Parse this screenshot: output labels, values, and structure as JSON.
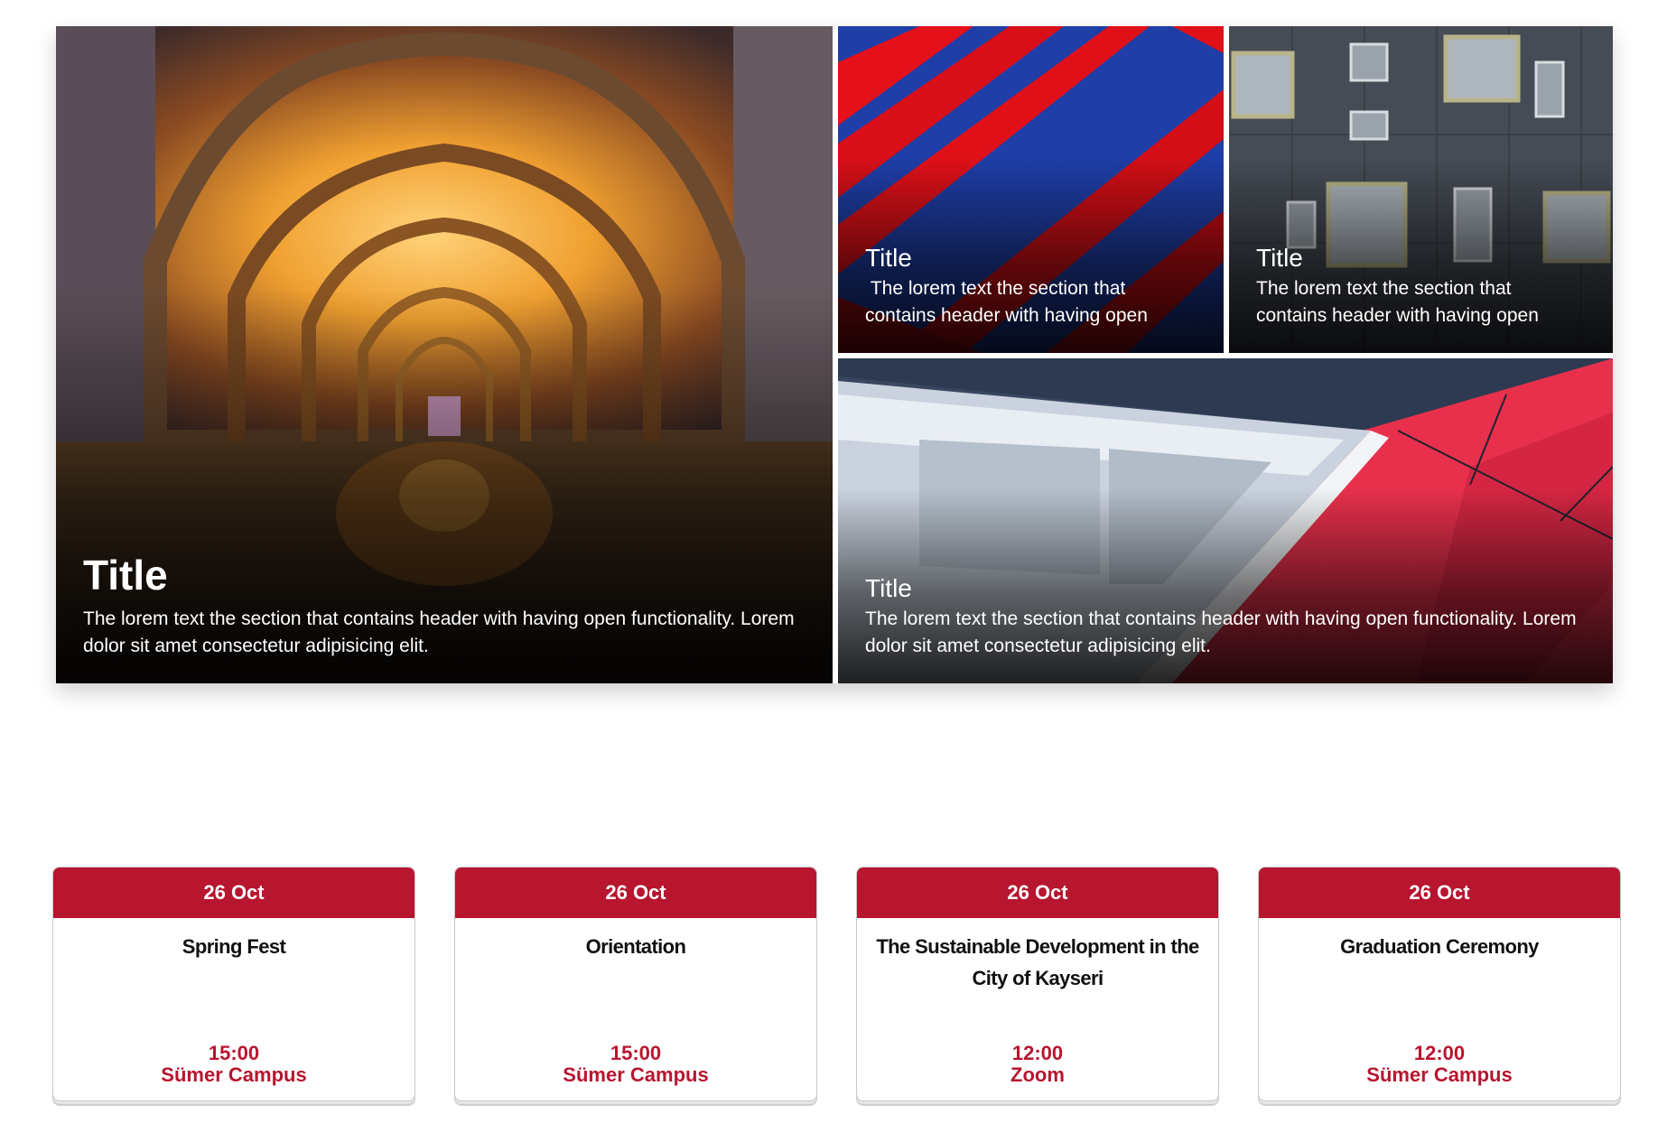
{
  "hero": {
    "main": {
      "title": "Title",
      "description": "The lorem text the section that contains header with having open functionality. Lorem dolor sit amet consectetur adipisicing elit."
    },
    "top_left": {
      "title": "Title",
      "description": " The lorem text the section that contains header with having open"
    },
    "top_right": {
      "title": "Title",
      "description": "The lorem text the section that contains header with having open"
    },
    "bottom": {
      "title": "Title",
      "description": "The lorem text the section that contains header with having open functionality. Lorem dolor sit amet consectetur adipisicing elit."
    }
  },
  "events": [
    {
      "date": "26 Oct",
      "name": "Spring Fest",
      "time": "15:00",
      "location": "Sümer Campus"
    },
    {
      "date": "26 Oct",
      "name": "Orientation",
      "time": "15:00",
      "location": "Sümer Campus"
    },
    {
      "date": "26 Oct",
      "name": "The Sustainable Development in the City of Kayseri",
      "time": "12:00",
      "location": "Zoom"
    },
    {
      "date": "26 Oct",
      "name": "Graduation Ceremony",
      "time": "12:00",
      "location": "Sümer Campus"
    }
  ],
  "colors": {
    "accent": "#b8152f"
  }
}
